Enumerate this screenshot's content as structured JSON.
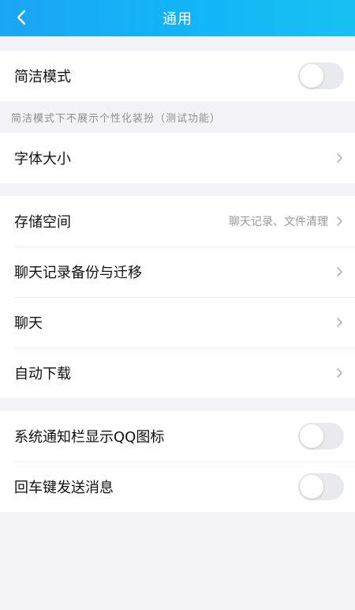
{
  "header": {
    "title": "通用",
    "back_icon": "chevron-left-icon"
  },
  "simple_mode": {
    "label": "简洁模式",
    "enabled": false,
    "note": "简洁模式下不展示个性化装扮（测试功能）"
  },
  "font_size": {
    "label": "字体大小"
  },
  "storage_group": {
    "storage": {
      "label": "存储空间",
      "value": "聊天记录、文件清理"
    },
    "backup": {
      "label": "聊天记录备份与迁移"
    },
    "chat": {
      "label": "聊天"
    },
    "auto_download": {
      "label": "自动下载"
    }
  },
  "toggles_group": {
    "notification_icon": {
      "label": "系统通知栏显示QQ图标",
      "enabled": false
    },
    "enter_send": {
      "label": "回车键发送消息",
      "enabled": false
    }
  },
  "colors": {
    "header_start": "#1ca5f5",
    "header_end": "#18c0f2",
    "background": "#f2f2f7"
  }
}
